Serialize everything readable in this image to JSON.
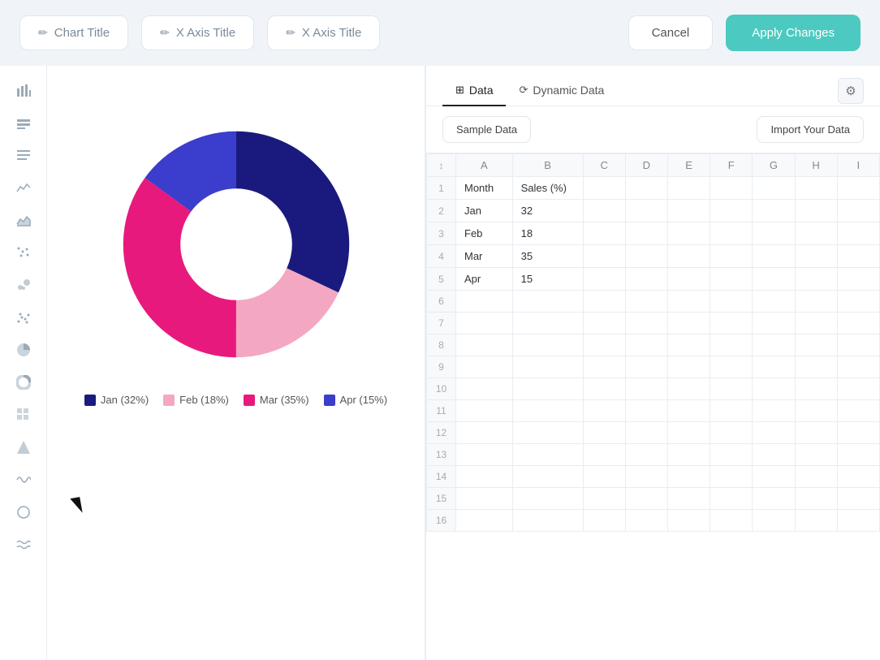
{
  "topbar": {
    "chart_title_label": "Chart Title",
    "x_axis_title_label": "X Axis Title",
    "y_axis_title_label": "X Axis Title",
    "cancel_label": "Cancel",
    "apply_label": "Apply Changes"
  },
  "sidebar": {
    "icons": [
      {
        "name": "bar-chart-icon",
        "symbol": "▬"
      },
      {
        "name": "column-chart-icon",
        "symbol": "▐"
      },
      {
        "name": "list-icon",
        "symbol": "☰"
      },
      {
        "name": "line-chart-icon",
        "symbol": "∧"
      },
      {
        "name": "area-chart-icon",
        "symbol": "⌇"
      },
      {
        "name": "scatter-icon",
        "symbol": "∷"
      },
      {
        "name": "bubble-icon",
        "symbol": "⁚"
      },
      {
        "name": "scatter2-icon",
        "symbol": "⠿"
      },
      {
        "name": "pie-icon",
        "symbol": "◔"
      },
      {
        "name": "donut-icon",
        "symbol": "○"
      },
      {
        "name": "grid-icon",
        "symbol": "⊞"
      },
      {
        "name": "triangle-icon",
        "symbol": "△"
      },
      {
        "name": "wave-icon",
        "symbol": "∿"
      },
      {
        "name": "circle-icon",
        "symbol": "◯"
      },
      {
        "name": "wave2-icon",
        "symbol": "≋"
      }
    ]
  },
  "chart": {
    "segments": [
      {
        "label": "Jan",
        "value": 32,
        "color": "#2d2d8f",
        "percent": 32
      },
      {
        "label": "Feb",
        "value": 18,
        "color": "#f4a7c3",
        "percent": 18
      },
      {
        "label": "Mar",
        "value": 35,
        "color": "#e8197c",
        "percent": 35
      },
      {
        "label": "Apr",
        "value": 15,
        "color": "#3b3dcc",
        "percent": 15
      }
    ]
  },
  "data_panel": {
    "tabs": [
      {
        "label": "Data",
        "active": true
      },
      {
        "label": "Dynamic Data",
        "active": false
      }
    ],
    "sample_data_label": "Sample Data",
    "import_label": "Import Your Data",
    "columns": [
      "",
      "A",
      "B",
      "C",
      "D",
      "E",
      "F",
      "G",
      "H",
      "I"
    ],
    "rows": [
      {
        "num": 1,
        "a": "Month",
        "b": "Sales (%)"
      },
      {
        "num": 2,
        "a": "Jan",
        "b": "32"
      },
      {
        "num": 3,
        "a": "Feb",
        "b": "18"
      },
      {
        "num": 4,
        "a": "Mar",
        "b": "35"
      },
      {
        "num": 5,
        "a": "Apr",
        "b": "15"
      },
      {
        "num": 6,
        "a": "",
        "b": ""
      },
      {
        "num": 7,
        "a": "",
        "b": ""
      },
      {
        "num": 8,
        "a": "",
        "b": ""
      },
      {
        "num": 9,
        "a": "",
        "b": ""
      },
      {
        "num": 10,
        "a": "",
        "b": ""
      },
      {
        "num": 11,
        "a": "",
        "b": ""
      },
      {
        "num": 12,
        "a": "",
        "b": ""
      },
      {
        "num": 13,
        "a": "",
        "b": ""
      },
      {
        "num": 14,
        "a": "",
        "b": ""
      },
      {
        "num": 15,
        "a": "",
        "b": ""
      },
      {
        "num": 16,
        "a": "",
        "b": ""
      }
    ]
  }
}
